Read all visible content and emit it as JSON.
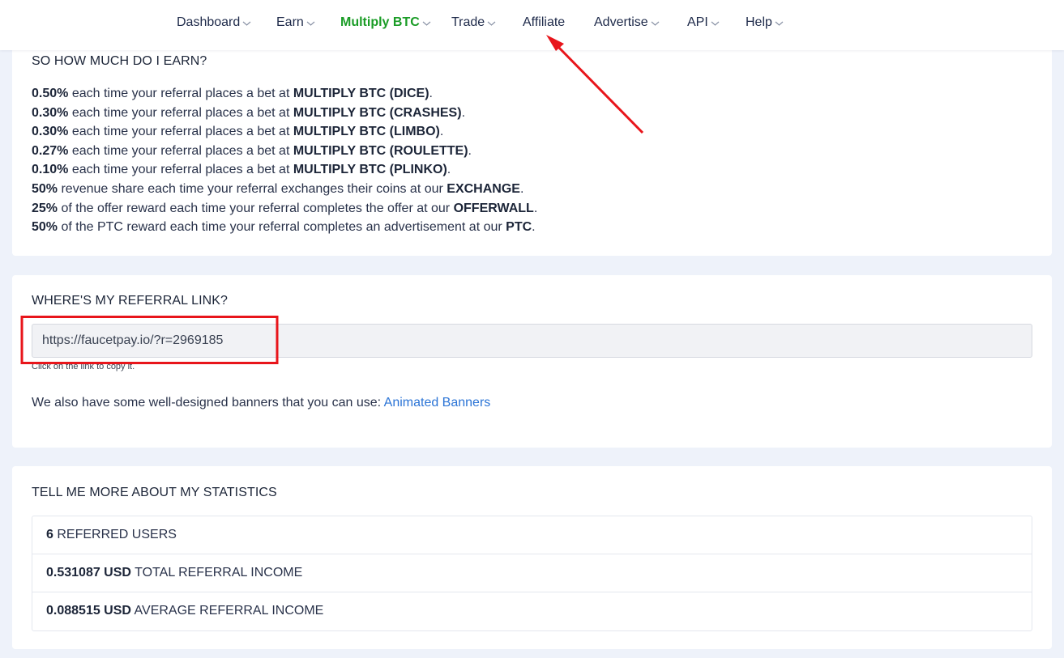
{
  "nav": {
    "items": [
      {
        "label": "Dashboard",
        "has_menu": true
      },
      {
        "label": "Earn",
        "has_menu": true
      },
      {
        "label": "Multiply BTC",
        "has_menu": true,
        "active": true
      },
      {
        "label": "Trade",
        "has_menu": true
      },
      {
        "label": "Affiliate",
        "has_menu": false
      },
      {
        "label": "Advertise",
        "has_menu": true
      },
      {
        "label": "API",
        "has_menu": true
      },
      {
        "label": "Help",
        "has_menu": true
      }
    ],
    "active_color": "#1a9c26"
  },
  "earnings": {
    "title": "SO HOW MUCH DO I EARN?",
    "lines": [
      {
        "value": "0.50%",
        "text": " each time your referral places a bet at ",
        "target": "MULTIPLY BTC (DICE)",
        "end": "."
      },
      {
        "value": "0.30%",
        "text": " each time your referral places a bet at ",
        "target": "MULTIPLY BTC (CRASHES)",
        "end": "."
      },
      {
        "value": "0.30%",
        "text": " each time your referral places a bet at ",
        "target": "MULTIPLY BTC (LIMBO)",
        "end": "."
      },
      {
        "value": "0.27%",
        "text": " each time your referral places a bet at ",
        "target": "MULTIPLY BTC (ROULETTE)",
        "end": "."
      },
      {
        "value": "0.10%",
        "text": " each time your referral places a bet at ",
        "target": "MULTIPLY BTC (PLINKO)",
        "end": "."
      },
      {
        "value": "50%",
        "text": " revenue share each time your referral exchanges their coins at our ",
        "target": "EXCHANGE",
        "end": "."
      },
      {
        "value": "25%",
        "text": " of the offer reward each time your referral completes the offer at our ",
        "target": "OFFERWALL",
        "end": "."
      },
      {
        "value": "50%",
        "text": " of the PTC reward each time your referral completes an advertisement at our ",
        "target": "PTC",
        "end": "."
      }
    ]
  },
  "referral": {
    "title": "WHERE'S MY REFERRAL LINK?",
    "link": "https://faucetpay.io/?r=2969185",
    "hint": "Click on the link to copy it.",
    "banner_text": "We also have some well-designed banners that you can use: ",
    "banner_link": "Animated Banners"
  },
  "stats": {
    "title": "TELL ME MORE ABOUT MY STATISTICS",
    "rows": [
      {
        "value": "6",
        "label": " REFERRED USERS"
      },
      {
        "value": "0.531087 USD",
        "label": " TOTAL REFERRAL INCOME"
      },
      {
        "value": "0.088515 USD",
        "label": " AVERAGE REFERRAL INCOME"
      }
    ]
  },
  "annotation_color": "#e8151b"
}
